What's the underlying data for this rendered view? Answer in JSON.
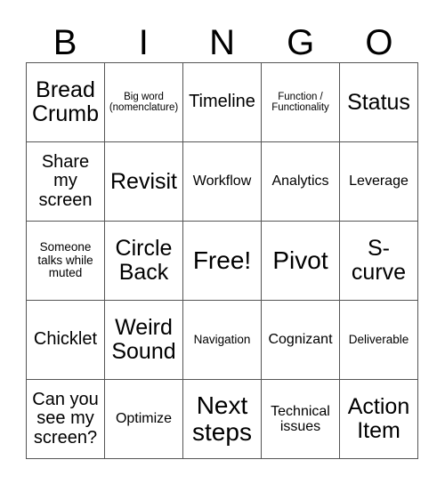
{
  "card": {
    "title": "BINGO Card",
    "header_letters": [
      "B",
      "I",
      "N",
      "G",
      "O"
    ],
    "colors": {
      "background": "#ffffff",
      "text": "#000000",
      "grid_line": "#555555"
    },
    "grid": {
      "columns": 5,
      "rows": 5,
      "free_space_label": "Free!",
      "free_space_position": "center"
    },
    "cells": [
      [
        {
          "text": "Bread\nCrumb",
          "size": "lg"
        },
        {
          "text": "Big word\n(nomenclature)",
          "size": "xxs"
        },
        {
          "text": "Timeline",
          "size": "md"
        },
        {
          "text": "Function /\nFunctionality",
          "size": "xxs"
        },
        {
          "text": "Status",
          "size": "lg"
        }
      ],
      [
        {
          "text": "Share\nmy\nscreen",
          "size": "md"
        },
        {
          "text": "Revisit",
          "size": "lg"
        },
        {
          "text": "Workflow",
          "size": "sm"
        },
        {
          "text": "Analytics",
          "size": "sm"
        },
        {
          "text": "Leverage",
          "size": "sm"
        }
      ],
      [
        {
          "text": "Someone\ntalks while\nmuted",
          "size": "xs"
        },
        {
          "text": "Circle\nBack",
          "size": "lg"
        },
        {
          "text": "Free!",
          "size": "xl"
        },
        {
          "text": "Pivot",
          "size": "xl"
        },
        {
          "text": "S-\ncurve",
          "size": "lg"
        }
      ],
      [
        {
          "text": "Chicklet",
          "size": "md"
        },
        {
          "text": "Weird\nSound",
          "size": "lg"
        },
        {
          "text": "Navigation",
          "size": "xs"
        },
        {
          "text": "Cognizant",
          "size": "sm"
        },
        {
          "text": "Deliverable",
          "size": "xs"
        }
      ],
      [
        {
          "text": "Can you\nsee my\nscreen?",
          "size": "md"
        },
        {
          "text": "Optimize",
          "size": "sm"
        },
        {
          "text": "Next\nsteps",
          "size": "xl"
        },
        {
          "text": "Technical\nissues",
          "size": "sm"
        },
        {
          "text": "Action\nItem",
          "size": "lg"
        }
      ]
    ]
  }
}
